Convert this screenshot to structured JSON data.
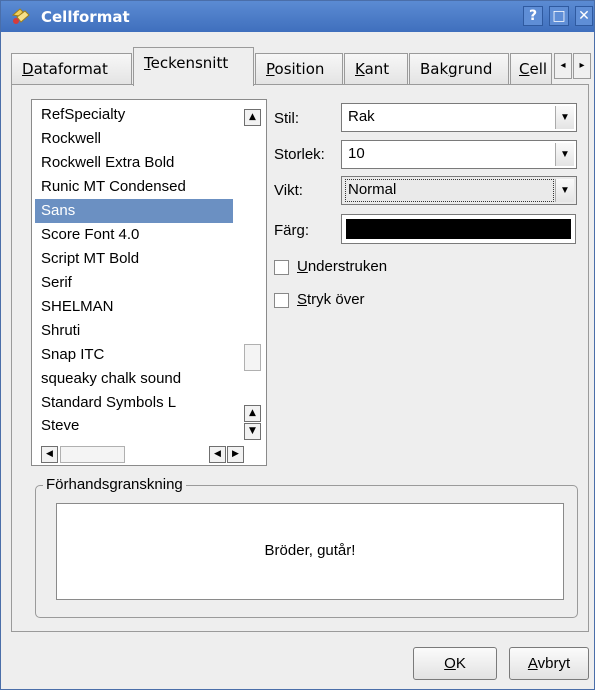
{
  "window": {
    "title": "Cellformat"
  },
  "titlebar_buttons": {
    "help": "?",
    "maximize": "□",
    "close": "✕"
  },
  "tabs": [
    {
      "label_pre": "",
      "mnemonic": "D",
      "label_post": "ataformat",
      "active": false
    },
    {
      "label_pre": "",
      "mnemonic": "T",
      "label_post": "eckensnitt",
      "active": true
    },
    {
      "label_pre": "",
      "mnemonic": "P",
      "label_post": "osition",
      "active": false
    },
    {
      "label_pre": "",
      "mnemonic": "K",
      "label_post": "ant",
      "active": false
    },
    {
      "label_pre": "Bak",
      "mnemonic": "g",
      "label_post": "rund",
      "active": false
    },
    {
      "label_pre": "",
      "mnemonic": "C",
      "label_post": "ell",
      "active": false
    }
  ],
  "tab_scroll": {
    "left": "◂",
    "right": "▸"
  },
  "font_list": {
    "items": [
      "RefSpecialty",
      "Rockwell",
      "Rockwell Extra Bold",
      "Runic MT Condensed",
      "Sans",
      "Score Font 4.0",
      "Script MT Bold",
      "Serif",
      "SHELMAN",
      "Shruti",
      "Snap ITC",
      "squeaky chalk sound",
      "Standard Symbols L",
      "Steve"
    ],
    "selected": "Sans"
  },
  "style": {
    "label": "Stil:",
    "value": "Rak"
  },
  "size": {
    "label": "Storlek:",
    "value": "10"
  },
  "weight": {
    "label": "Vikt:",
    "value": "Normal"
  },
  "color": {
    "label": "Färg:",
    "value": "#000000"
  },
  "underline": {
    "mnemonic": "U",
    "rest": "nderstruken",
    "checked": false
  },
  "strikeout": {
    "mnemonic": "S",
    "rest": "tryk över",
    "checked": false
  },
  "preview": {
    "title": "Förhandsgranskning",
    "text": "Bröder, gutår!"
  },
  "buttons": {
    "ok": {
      "mnemonic": "O",
      "rest": "K"
    },
    "cancel": {
      "mnemonic": "A",
      "rest": "vbryt"
    }
  },
  "colors": {
    "titlebar": "#4a79c7",
    "selection": "#6b90c2",
    "dialog_bg": "#eeeeee"
  }
}
